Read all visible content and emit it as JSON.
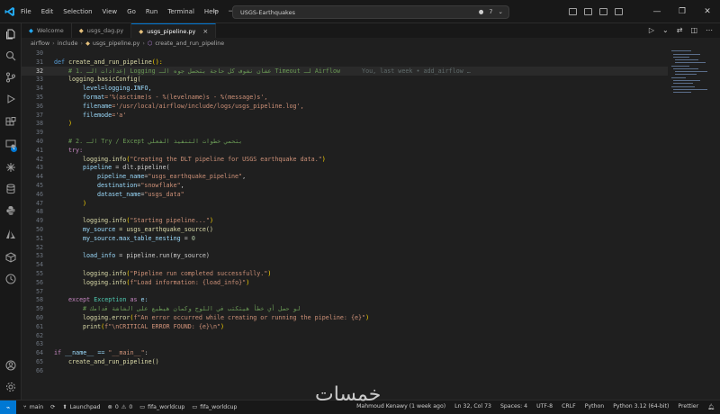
{
  "titlebar": {
    "menu": [
      "File",
      "Edit",
      "Selection",
      "View",
      "Go",
      "Run",
      "Terminal",
      "Help"
    ],
    "search_text": "USGS-Earthquakes",
    "sc_count": "7"
  },
  "tabs": [
    {
      "label": "Welcome",
      "active": false
    },
    {
      "label": "usgs_dag.py",
      "active": false
    },
    {
      "label": "usgs_pipeline.py",
      "active": true
    }
  ],
  "breadcrumb": [
    "airflow",
    "include",
    "usgs_pipeline.py",
    "create_and_run_pipeline"
  ],
  "editor": {
    "current_line": 32,
    "blame": "You, last week • add_airflow …"
  },
  "code_lines": [
    {
      "n": "30"
    },
    {
      "n": "31"
    },
    {
      "n": "32"
    },
    {
      "n": "33"
    },
    {
      "n": "34"
    },
    {
      "n": "35"
    },
    {
      "n": "36"
    },
    {
      "n": "37"
    },
    {
      "n": "38"
    },
    {
      "n": "39"
    },
    {
      "n": "40"
    },
    {
      "n": "41"
    },
    {
      "n": "42"
    },
    {
      "n": "43"
    },
    {
      "n": "44"
    },
    {
      "n": "45"
    },
    {
      "n": "46"
    },
    {
      "n": "47"
    },
    {
      "n": "48"
    },
    {
      "n": "49"
    },
    {
      "n": "50"
    },
    {
      "n": "51"
    },
    {
      "n": "52"
    },
    {
      "n": "53"
    },
    {
      "n": "54"
    },
    {
      "n": "55"
    },
    {
      "n": "56"
    },
    {
      "n": "57"
    },
    {
      "n": "58"
    },
    {
      "n": "59"
    },
    {
      "n": "60"
    },
    {
      "n": "61"
    },
    {
      "n": "62"
    },
    {
      "n": "63"
    },
    {
      "n": "64"
    },
    {
      "n": "65"
    },
    {
      "n": "66"
    }
  ],
  "code": {
    "l31_def": "def",
    "l31_fn": "create_and_run_pipeline",
    "l31_rest": "():",
    "l32": "# 1. إعدادات الـ Logging عشان نشوف كل حاجة بتحصل جوه الـ Timeout لـ Airflow",
    "l33": "logging.basicConfig(",
    "l34_k": "level",
    "l34_v": "=logging.INFO,",
    "l35_k": "format",
    "l35_v": "='%(asctime)s - %(levelname)s - %(message)s',",
    "l36_k": "filename",
    "l36_v": "='/usr/local/airflow/include/logs/usgs_pipeline.log',",
    "l37_k": "filemode",
    "l37_v": "='a'",
    "l38": ")",
    "l40": "# 2. الـ Try / Except بتحمي خطوات التنفيذ الفعلي",
    "l41": "try:",
    "l42_fn": "logging.info",
    "l42_s": "\"Creating the DLT pipeline for USGS earthquake data.\"",
    "l43_a": "pipeline",
    "l43_b": " = dlt.pipeline(",
    "l44_k": "pipeline_name",
    "l44_s": "\"usgs_earthquake_pipeline\"",
    "l45_k": "destination",
    "l45_s": "\"snowflake\"",
    "l46_k": "dataset_name",
    "l46_s": "\"usgs_data\"",
    "l47": ")",
    "l49_fn": "logging.info",
    "l49_s": "\"Starting pipeline...\"",
    "l50_a": "my_source",
    "l50_b": " = usgs_earthquake_source()",
    "l51_a": "my_source.max_table_nesting",
    "l51_b": " = ",
    "l51_n": "0",
    "l53_a": "load_info",
    "l53_b": " = pipeline.run(my_source)",
    "l55_fn": "logging.info",
    "l55_s": "\"Pipeline run completed successfully.\"",
    "l56_fn": "logging.info",
    "l56_s": "f\"Load information: {load_info}\"",
    "l58_a": "except",
    "l58_b": " Exception ",
    "l58_c": "as",
    "l58_d": " e:",
    "l59": "# لو حصل أي خطأ هيتكتب في اللوج وكمان هيطبع على الشاشة قدامك",
    "l60_fn": "logging.error",
    "l60_s": "f\"An error occurred while creating or running the pipeline: {e}\"",
    "l61_fn": "print",
    "l61_s": "f\"\\nCRITICAL ERROR FOUND: {e}\\n\"",
    "l64_a": "if",
    "l64_b": " __name__ == ",
    "l64_s": "\"__main__\"",
    "l64_c": ":",
    "l65": "create_and_run_pipeline()"
  },
  "statusbar": {
    "branch": "main",
    "launchpad": "Launchpad",
    "errors": "0",
    "warnings": "0",
    "env1": "fifa_worldcup",
    "env2": "fifa_worldcup",
    "author": "Mahmoud Kenawy (1 week ago)",
    "position": "Ln 32, Col 73",
    "spaces": "Spaces: 4",
    "encoding": "UTF-8",
    "eol": "CRLF",
    "language": "Python",
    "interpreter": "Python 3.12 (64-bit)",
    "prettier": "Prettier"
  },
  "watermark": "خمسات",
  "colors": {
    "accent": "#0078d4",
    "background": "#1f1f1f"
  }
}
